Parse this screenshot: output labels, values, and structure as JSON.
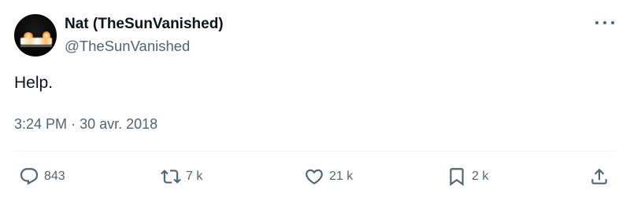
{
  "tweet": {
    "display_name": "Nat (TheSunVanished)",
    "handle": "@TheSunVanished",
    "text": "Help.",
    "time": "3:24 PM",
    "separator": "·",
    "date": "30 avr. 2018"
  },
  "actions": {
    "replies": "843",
    "reposts": "7 k",
    "likes": "21 k",
    "bookmarks": "2 k"
  },
  "icons": {
    "more": "more-options-icon",
    "reply": "reply-icon",
    "repost": "repost-icon",
    "like": "heart-icon",
    "bookmark": "bookmark-icon",
    "share": "share-icon"
  },
  "colors": {
    "text": "#0f1419",
    "secondary": "#536471"
  }
}
